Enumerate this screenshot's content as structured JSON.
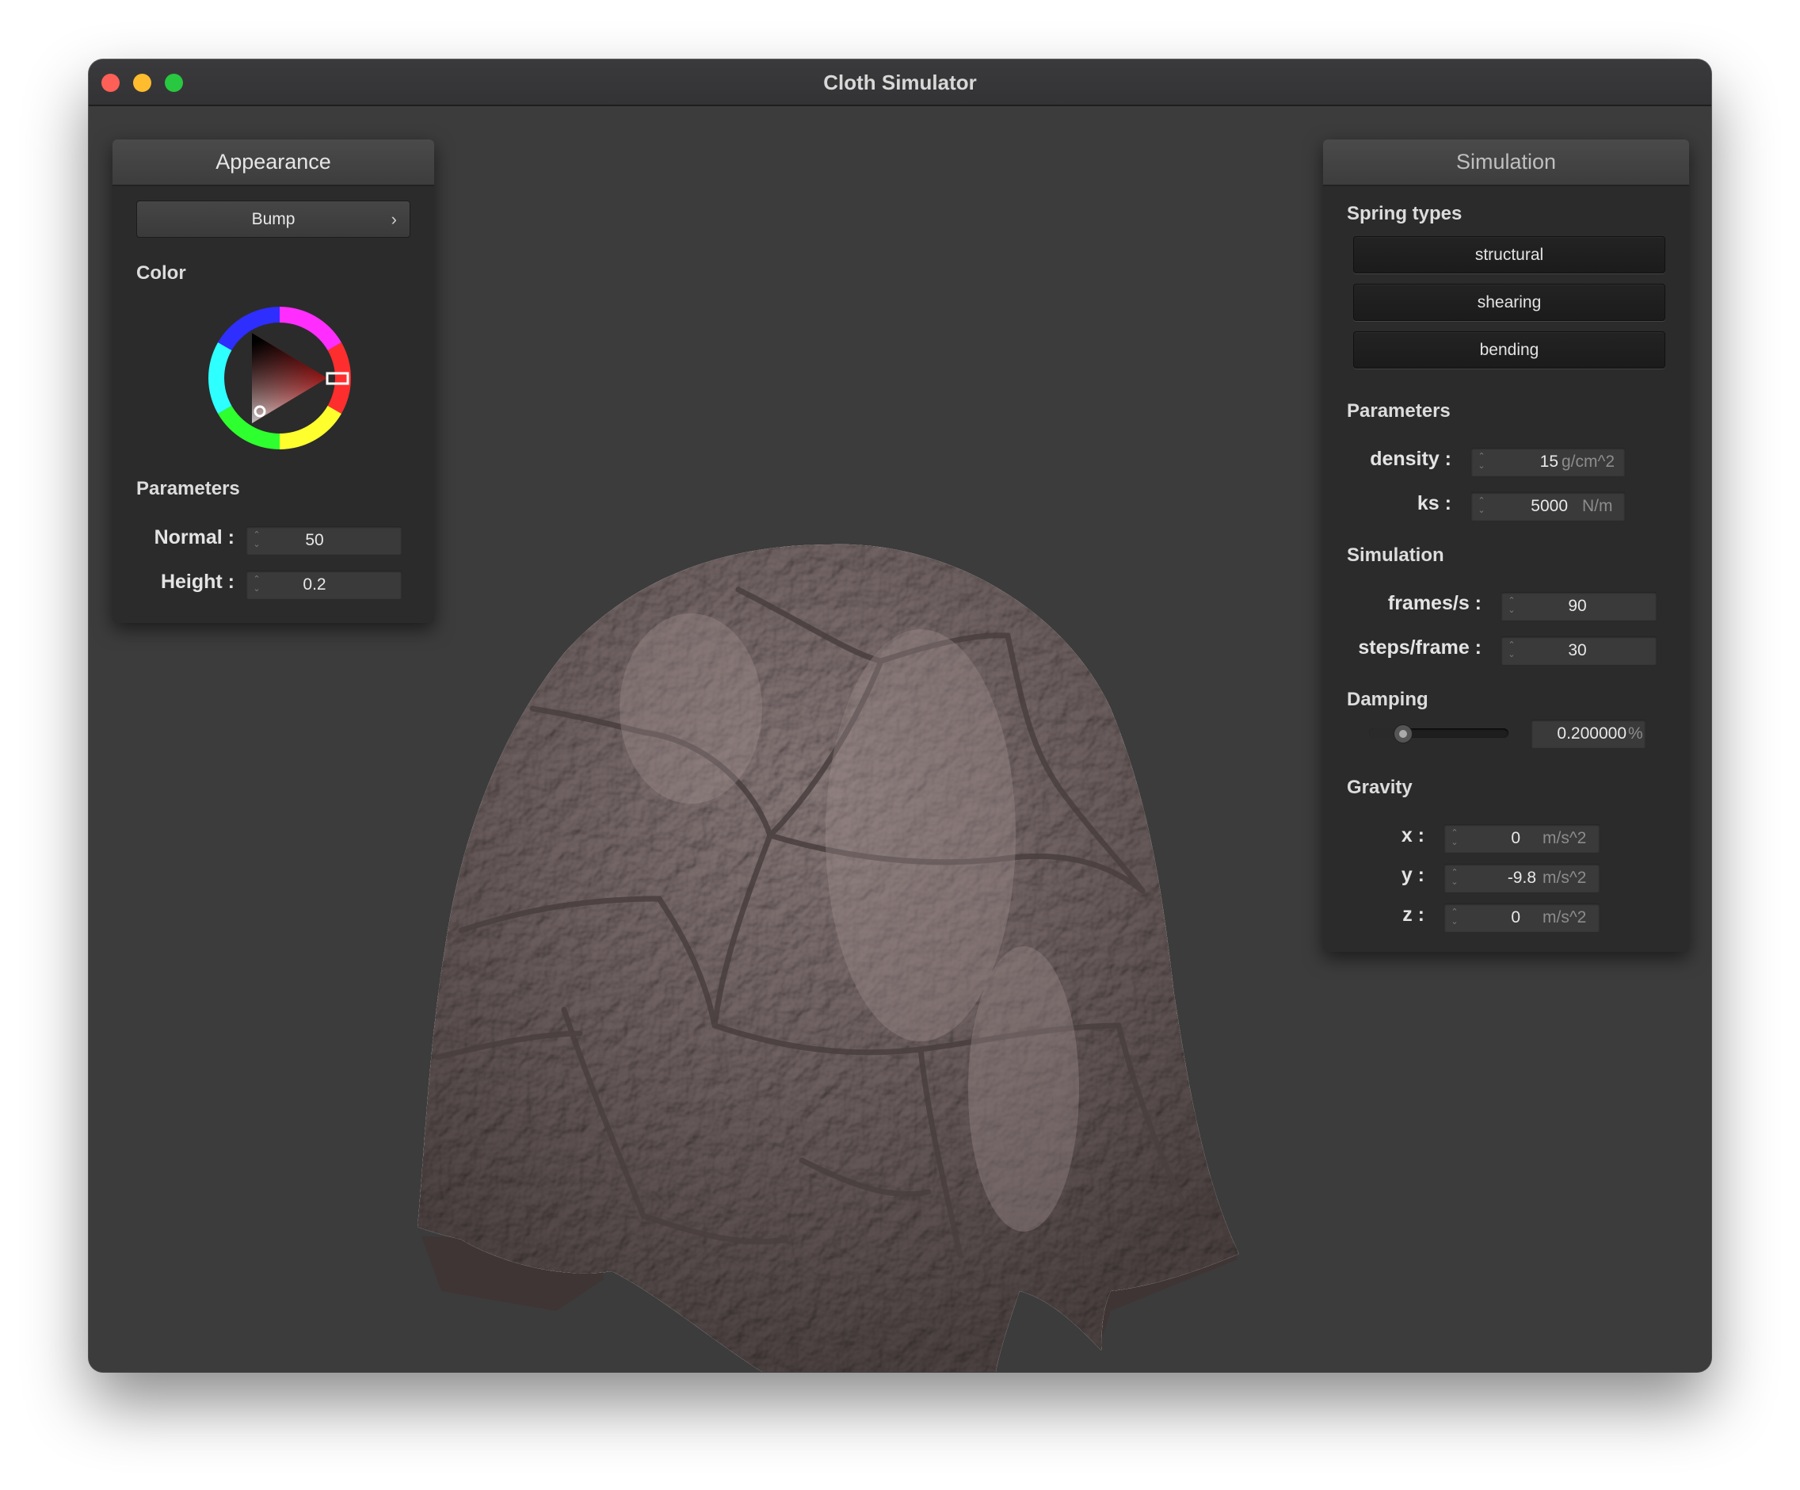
{
  "window": {
    "title": "Cloth Simulator"
  },
  "appearance": {
    "header": "Appearance",
    "shader_select": "Bump",
    "color_label": "Color",
    "color_value": "#e02020",
    "parameters_label": "Parameters",
    "normal_label": "Normal :",
    "normal_value": "50",
    "height_label": "Height :",
    "height_value": "0.2"
  },
  "simulation": {
    "header": "Simulation",
    "spring_types_label": "Spring types",
    "spring_buttons": [
      "structural",
      "shearing",
      "bending"
    ],
    "parameters_label": "Parameters",
    "density_label": "density :",
    "density_value": "15",
    "density_unit": "g/cm^2",
    "ks_label": "ks :",
    "ks_value": "5000",
    "ks_unit": "N/m",
    "simulation_label": "Simulation",
    "fps_label": "frames/s :",
    "fps_value": "90",
    "steps_label": "steps/frame :",
    "steps_value": "30",
    "damping_label": "Damping",
    "damping_level": 0.2,
    "damping_value": "0.200000",
    "damping_unit": "%",
    "gravity_label": "Gravity",
    "gx_label": "x :",
    "gx_value": "0",
    "gy_label": "y :",
    "gy_value": "-9.8",
    "gz_label": "z :",
    "gz_value": "0",
    "gravity_unit": "m/s^2"
  },
  "colors": {
    "cloth": "#6b5c5c",
    "background": "#3c3c3c",
    "panel": "#2b2b2b"
  }
}
